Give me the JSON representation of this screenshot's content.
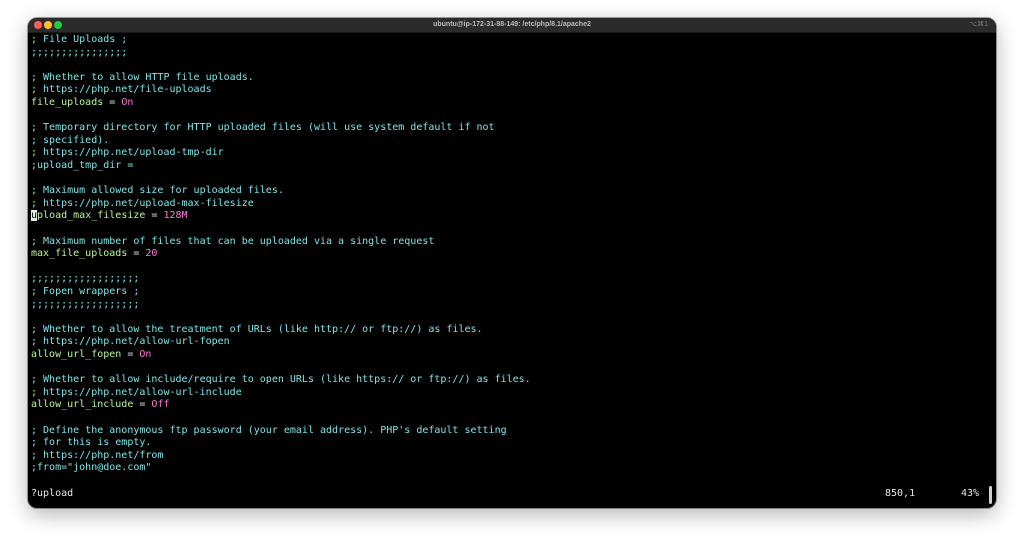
{
  "window": {
    "title": "ubuntu@ip-172-31-88-149: /etc/php/8.1/apache2",
    "shortcut": "⌥⌘1"
  },
  "editor": {
    "lines": [
      {
        "type": "comment",
        "text": "; File Uploads ;"
      },
      {
        "type": "comment",
        "text": ";;;;;;;;;;;;;;;;"
      },
      {
        "type": "blank",
        "text": ""
      },
      {
        "type": "comment",
        "text": "; Whether to allow HTTP file uploads."
      },
      {
        "type": "comment",
        "text": "; https://php.net/file-uploads"
      },
      {
        "type": "setting",
        "key": "file_uploads",
        "eq": " = ",
        "value": "On"
      },
      {
        "type": "blank",
        "text": ""
      },
      {
        "type": "comment",
        "text": "; Temporary directory for HTTP uploaded files (will use system default if not"
      },
      {
        "type": "comment",
        "text": "; specified)."
      },
      {
        "type": "comment",
        "text": "; https://php.net/upload-tmp-dir"
      },
      {
        "type": "comment",
        "text": ";upload_tmp_dir ="
      },
      {
        "type": "blank",
        "text": ""
      },
      {
        "type": "comment",
        "text": "; Maximum allowed size for uploaded files."
      },
      {
        "type": "comment",
        "text": "; https://php.net/upload-max-filesize"
      },
      {
        "type": "setting",
        "cursor": "u",
        "key": "pload_max_filesize",
        "eq": " = ",
        "value": "128M"
      },
      {
        "type": "blank",
        "text": ""
      },
      {
        "type": "comment",
        "text": "; Maximum number of files that can be uploaded via a single request"
      },
      {
        "type": "setting",
        "key": "max_file_uploads",
        "eq": " = ",
        "value": "20"
      },
      {
        "type": "blank",
        "text": ""
      },
      {
        "type": "comment",
        "text": ";;;;;;;;;;;;;;;;;;"
      },
      {
        "type": "comment",
        "text": "; Fopen wrappers ;"
      },
      {
        "type": "comment",
        "text": ";;;;;;;;;;;;;;;;;;"
      },
      {
        "type": "blank",
        "text": ""
      },
      {
        "type": "comment",
        "text": "; Whether to allow the treatment of URLs (like http:// or ftp://) as files."
      },
      {
        "type": "comment",
        "text": "; https://php.net/allow-url-fopen"
      },
      {
        "type": "setting",
        "key": "allow_url_fopen",
        "eq": " = ",
        "value": "On"
      },
      {
        "type": "blank",
        "text": ""
      },
      {
        "type": "comment",
        "text": "; Whether to allow include/require to open URLs (like https:// or ftp://) as files."
      },
      {
        "type": "comment",
        "text": "; https://php.net/allow-url-include"
      },
      {
        "type": "setting",
        "key": "allow_url_include",
        "eq": " = ",
        "value": "Off"
      },
      {
        "type": "blank",
        "text": ""
      },
      {
        "type": "comment",
        "text": "; Define the anonymous ftp password (your email address). PHP's default setting"
      },
      {
        "type": "comment",
        "text": "; for this is empty."
      },
      {
        "type": "comment",
        "text": "; https://php.net/from"
      },
      {
        "type": "comment",
        "text": ";from=\"john@doe.com\""
      }
    ]
  },
  "status": {
    "command": "?upload",
    "position": "850,1",
    "percent": "43%"
  },
  "colors": {
    "comment": "#7ee5e5",
    "key": "#b9f59b",
    "value": "#ff7bd5",
    "background": "#000000"
  }
}
